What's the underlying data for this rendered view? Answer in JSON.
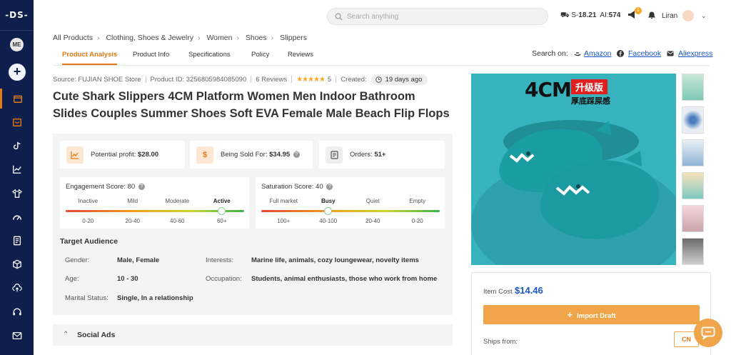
{
  "sidebar": {
    "logo": "-DS-",
    "avatar_initials": "ME",
    "add_label": "+"
  },
  "topbar": {
    "search_placeholder": "Search anything",
    "credits_s_label": "S-",
    "credits_s_value": "18.21",
    "credits_ai_label": "AI:",
    "credits_ai_value": "574",
    "cart_badge": "1",
    "user_name": "Liran"
  },
  "breadcrumb": [
    "All Products",
    "Clothing, Shoes & Jewelry",
    "Women",
    "Shoes",
    "Slippers"
  ],
  "tabs": [
    "Product Analysis",
    "Product Info",
    "Specifications",
    "Policy",
    "Reviews"
  ],
  "search_on": {
    "label": "Search on:",
    "links": [
      "Amazon",
      "Facebook",
      "Aliexpress"
    ]
  },
  "source": {
    "source": "Source: FUJIAN SHOE Store",
    "product_id": "Product ID: 3256805984085090",
    "reviews": "6 Reviews",
    "rating": "5",
    "created_label": "Created:",
    "created_value": "19 days ago"
  },
  "title": "Cute Shark Slippers 4CM Platform Women Men Indoor Bathroom Slides Couples Summer Shoes Soft EVA Female Male Beach Flip Flops",
  "stats": {
    "profit_label": "Potential profit:",
    "profit_value": "$28.00",
    "sold_label": "Being Sold For:",
    "sold_value": "$34.95",
    "orders_label": "Orders:",
    "orders_value": "51+"
  },
  "engagement": {
    "label": "Engagement Score:",
    "value": "80",
    "levels": [
      "Inactive",
      "Mild",
      "Moderate",
      "Active"
    ],
    "ranges": [
      "0-20",
      "20-40",
      "40-60",
      "60+"
    ],
    "active_index": 3,
    "level_fraction": 0.8
  },
  "saturation": {
    "label": "Saturation Score:",
    "value": "40",
    "levels": [
      "Full market",
      "Busy",
      "Quiet",
      "Empty"
    ],
    "ranges": [
      "100+",
      "40-100",
      "20-40",
      "0-20"
    ],
    "active_index": 1,
    "level_fraction": 0.4
  },
  "audience": {
    "title": "Target Audience",
    "gender_label": "Gender:",
    "gender_value": "Male, Female",
    "age_label": "Age:",
    "age_value": "10 - 30",
    "marital_label": "Marital Status:",
    "marital_value": "Single, In a relationship",
    "interests_label": "Interests:",
    "interests_value": "Marine life, animals, cozy loungewear, novelty items",
    "occupation_label": "Occupation:",
    "occupation_value": "Students, animal enthusiasts, those who work from home"
  },
  "social_ads": "Social Ads",
  "image": {
    "badge_text": "4CM",
    "cn_text_1": "升级版",
    "cn_text_2": "厚底踩屎感"
  },
  "buy": {
    "cost_label": "Item Cost",
    "cost_value": "$14.46",
    "import_label": "Import Draft",
    "ships_label": "Ships from:",
    "ships_value": "CN"
  },
  "colors": {
    "sidebar": "#0e1f4d",
    "accent": "#e07a16",
    "button": "#f0a54a",
    "link": "#1a56c5",
    "product_bg": "#36b3bd"
  }
}
